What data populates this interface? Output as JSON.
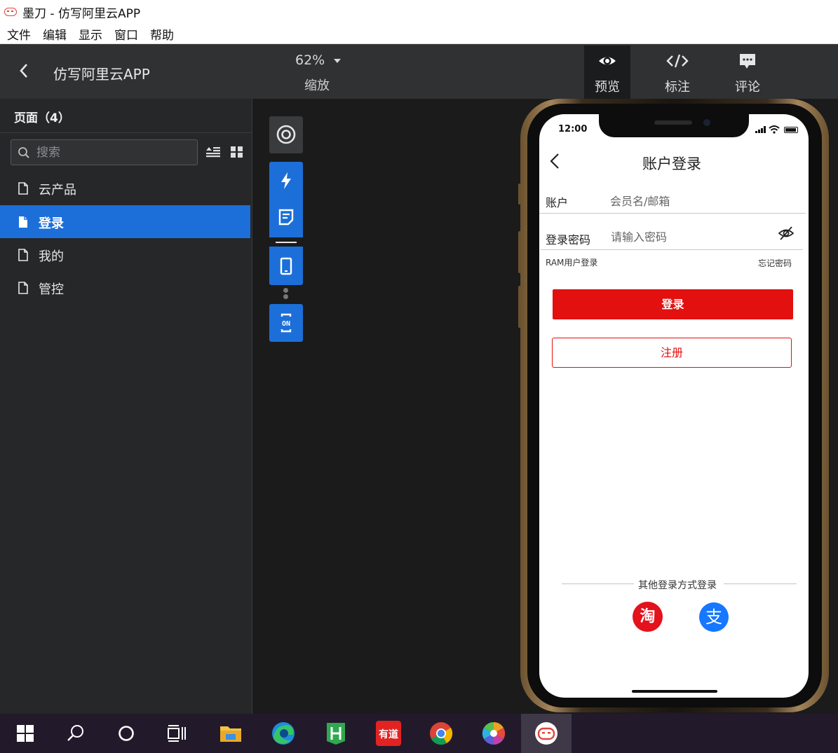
{
  "window": {
    "title": "墨刀 - 仿写阿里云APP"
  },
  "menu": [
    "文件",
    "编辑",
    "显示",
    "窗口",
    "帮助"
  ],
  "header": {
    "project_title": "仿写阿里云APP",
    "zoom_value": "62%",
    "zoom_label": "缩放",
    "modes": [
      {
        "label": "预览",
        "icon": "eye-icon",
        "active": true
      },
      {
        "label": "标注",
        "icon": "code-icon",
        "active": false
      },
      {
        "label": "评论",
        "icon": "comment-icon",
        "active": false
      }
    ]
  },
  "sidebar": {
    "title": "页面（4）",
    "search_placeholder": "搜索",
    "pages": [
      {
        "label": "云产品",
        "active": false
      },
      {
        "label": "登录",
        "active": true
      },
      {
        "label": "我的",
        "active": false
      },
      {
        "label": "管控",
        "active": false
      }
    ]
  },
  "toolbar": {
    "items": [
      "target-icon",
      "lightning-icon",
      "note-icon",
      "phone-icon",
      "on-icon"
    ]
  },
  "phone": {
    "status_time": "12:00",
    "nav_title": "账户登录",
    "account_label": "账户",
    "account_placeholder": "会员名/邮箱",
    "password_label": "登录密码",
    "password_placeholder": "请输入密码",
    "ram_link": "RAM用户登录",
    "forgot_link": "忘记密码",
    "login_button": "登录",
    "register_button": "注册",
    "other_login_text": "其他登录方式登录",
    "taobao_glyph": "淘",
    "alipay_glyph": "支"
  },
  "colors": {
    "accent": "#1c6fd8",
    "brand_red": "#e2100f",
    "alipay_blue": "#1677ff"
  }
}
